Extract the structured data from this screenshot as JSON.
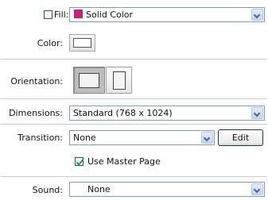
{
  "fill": {
    "label": "Fill:",
    "checked": false,
    "value": "Solid Color",
    "swatch_color": "#c0267a"
  },
  "color": {
    "label": "Color:"
  },
  "orientation": {
    "label": "Orientation:",
    "selected": "landscape"
  },
  "dimensions": {
    "label": "Dimensions:",
    "value": "Standard (768 x 1024)"
  },
  "transition": {
    "label": "Transition:",
    "value": "None",
    "edit_label": "Edit"
  },
  "master": {
    "label": "Use Master Page",
    "checked": true
  },
  "sound": {
    "label": "Sound:",
    "value": "None"
  }
}
